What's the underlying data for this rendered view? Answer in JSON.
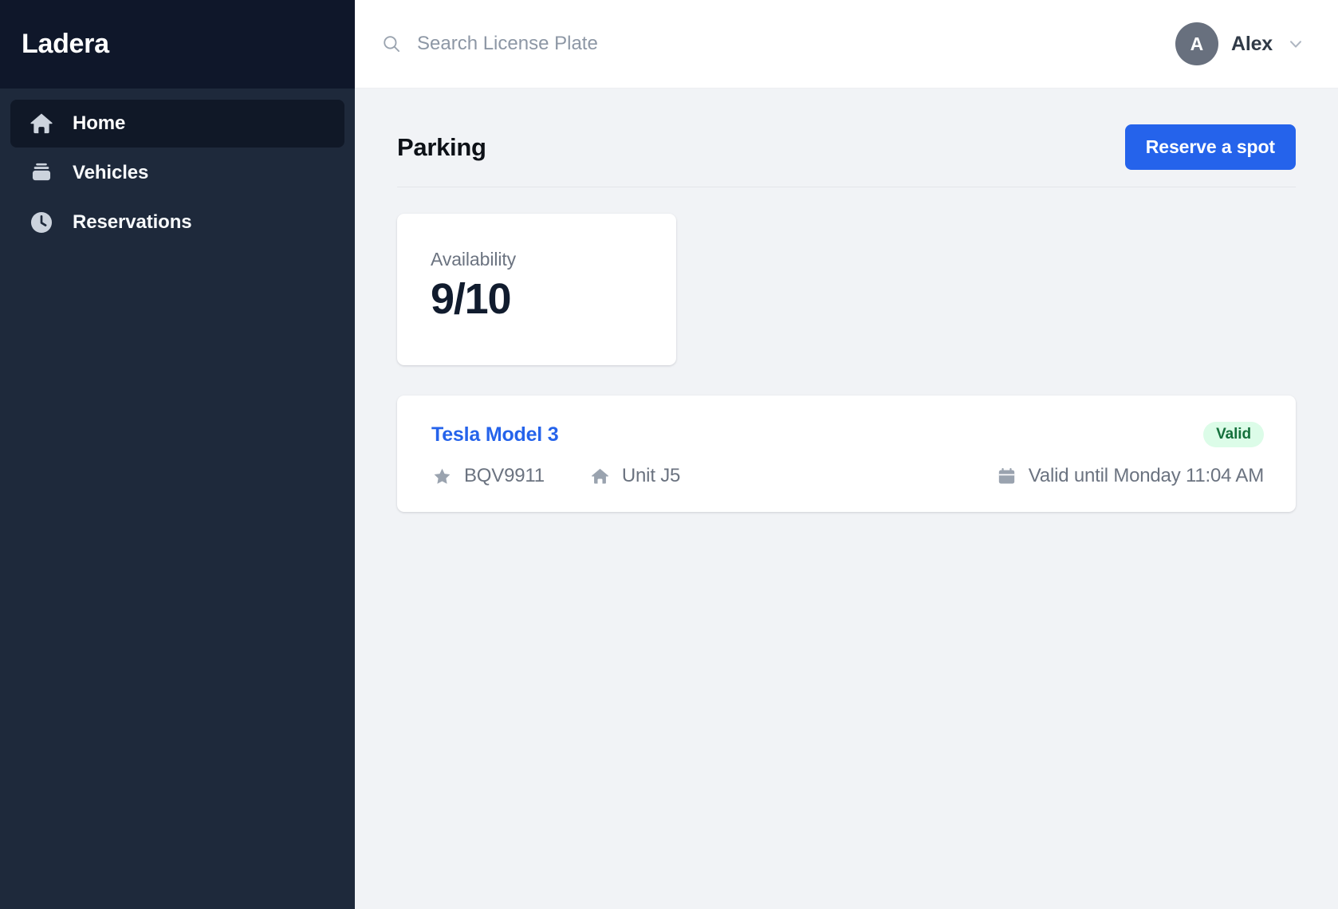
{
  "brand": {
    "name": "Ladera"
  },
  "sidebar": {
    "items": [
      {
        "label": "Home",
        "icon": "home-icon",
        "active": true
      },
      {
        "label": "Vehicles",
        "icon": "car-icon",
        "active": false
      },
      {
        "label": "Reservations",
        "icon": "clock-icon",
        "active": false
      }
    ]
  },
  "topbar": {
    "search": {
      "placeholder": "Search License Plate",
      "value": "",
      "icon": "search-icon"
    },
    "user": {
      "initial": "A",
      "name": "Alex",
      "chevron": "chevron-down-icon"
    }
  },
  "page": {
    "title": "Parking",
    "reserve_button": "Reserve a spot"
  },
  "availability": {
    "label": "Availability",
    "value": "9/10"
  },
  "vehicle": {
    "name": "Tesla Model 3",
    "status": "Valid",
    "license_plate": "BQV9911",
    "unit": "Unit J5",
    "validity": "Valid until Monday 11:04 AM",
    "plate_icon": "star-icon",
    "unit_icon": "home-icon",
    "validity_icon": "calendar-icon"
  },
  "colors": {
    "sidebar_bg": "#1e293b",
    "sidebar_header_bg": "#0f172a",
    "accent_blue": "#2563eb",
    "badge_bg": "#dcfce8",
    "badge_text": "#15703c",
    "page_bg": "#f1f3f6"
  }
}
